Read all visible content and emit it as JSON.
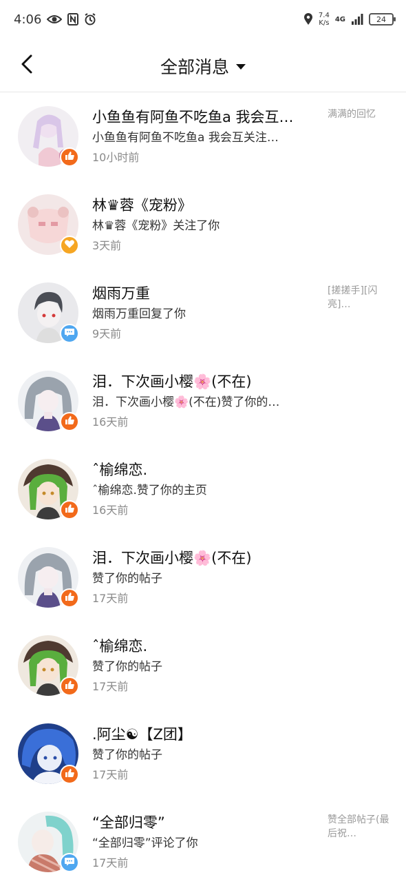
{
  "status_bar": {
    "time": "4:06",
    "net_speed_value": "7.4",
    "net_speed_unit": "K/s",
    "network": "4G",
    "battery": "24",
    "icons": [
      "eye-icon",
      "nfc-icon",
      "alarm-icon",
      "location-icon",
      "signal-icon"
    ]
  },
  "header": {
    "title": "全部消息",
    "back_icon": "chevron-left-icon",
    "dropdown_icon": "caret-down-icon"
  },
  "colors": {
    "like_badge": "#f26a1b",
    "follow_badge": "#f6a623",
    "comment_badge": "#4fa7f0",
    "time_text": "#8a8a8a"
  },
  "messages": [
    {
      "name": "小鱼鱼有阿鱼不吃鱼a 我会互…",
      "desc": "小鱼鱼有阿鱼不吃鱼a 我会互关注…",
      "time": "10小时前",
      "ref": "满满的回忆",
      "badge": "like-icon"
    },
    {
      "name": "林♛蓉《宠粉》",
      "desc": "林♛蓉《宠粉》关注了你",
      "time": "3天前",
      "ref": "",
      "badge": "heart-icon"
    },
    {
      "name": "烟雨万重",
      "desc": "烟雨万重回复了你",
      "time": "9天前",
      "ref": "[搓搓手][闪亮]…",
      "badge": "comment-icon"
    },
    {
      "name": "泪．下次画小樱🌸(不在)",
      "desc": "泪．下次画小樱🌸(不在)赞了你的…",
      "time": "16天前",
      "ref": "",
      "badge": "like-icon"
    },
    {
      "name": "ˆ榆绵恋.",
      "desc": "ˆ榆绵恋.赞了你的主页",
      "time": "16天前",
      "ref": "",
      "badge": "like-icon"
    },
    {
      "name": "泪．下次画小樱🌸(不在)",
      "desc": "赞了你的帖子",
      "time": "17天前",
      "ref": "",
      "badge": "like-icon"
    },
    {
      "name": "ˆ榆绵恋.",
      "desc": "赞了你的帖子",
      "time": "17天前",
      "ref": "",
      "badge": "like-icon"
    },
    {
      "name": ".阿尘☯【Z团】",
      "desc": "赞了你的帖子",
      "time": "17天前",
      "ref": "",
      "badge": "like-icon"
    },
    {
      "name": "“全部归零”",
      "desc": "“全部归零”评论了你",
      "time": "17天前",
      "ref": "赞全部帖子(最后祝…",
      "badge": "comment-icon"
    }
  ]
}
